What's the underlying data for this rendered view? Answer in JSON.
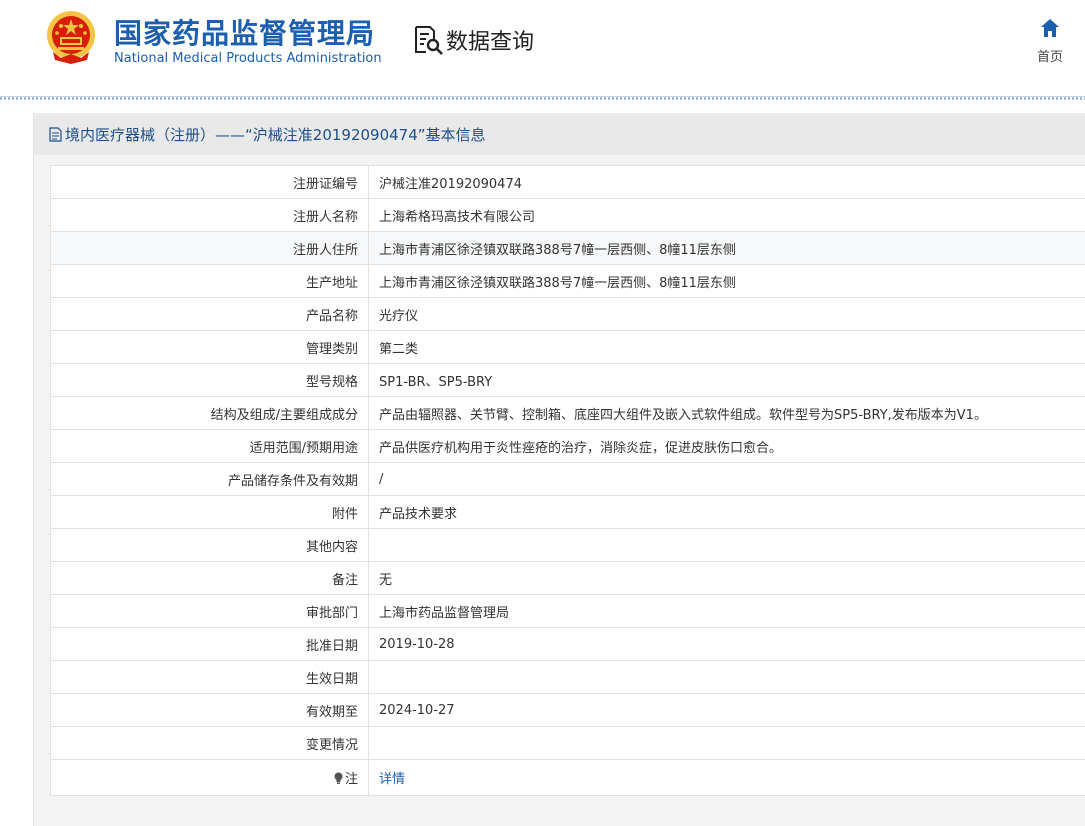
{
  "header": {
    "org_name_cn": "国家药品监督管理局",
    "org_name_en": "National Medical Products Administration",
    "query_label": "数据查询",
    "home_label": "首页"
  },
  "colors": {
    "brand_blue": "#1c5fae",
    "link_blue": "#1c5fae",
    "emblem_red": "#d81e06",
    "emblem_gold": "#f6c343"
  },
  "icons": {
    "emblem": "national-emblem-icon",
    "query": "document-search-icon",
    "home": "home-icon",
    "title": "document-icon",
    "note": "lightbulb-icon"
  },
  "panel": {
    "title": "境内医疗器械（注册）——“沪械注准20192090474”基本信息"
  },
  "rows": [
    {
      "label": "注册证编号",
      "value": "沪械注准20192090474"
    },
    {
      "label": "注册人名称",
      "value": "上海希格玛高技术有限公司"
    },
    {
      "label": "注册人住所",
      "value": "上海市青浦区徐泾镇双联路388号7幢一层西侧、8幢11层东侧"
    },
    {
      "label": "生产地址",
      "value": "上海市青浦区徐泾镇双联路388号7幢一层西侧、8幢11层东侧"
    },
    {
      "label": "产品名称",
      "value": "光疗仪"
    },
    {
      "label": "管理类别",
      "value": "第二类"
    },
    {
      "label": "型号规格",
      "value": "SP1-BR、SP5-BRY"
    },
    {
      "label": "结构及组成/主要组成成分",
      "value": "产品由辐照器、关节臂、控制箱、底座四大组件及嵌入式软件组成。软件型号为SP5-BRY,发布版本为V1。"
    },
    {
      "label": "适用范围/预期用途",
      "value": "产品供医疗机构用于炎性痤疮的治疗，消除炎症，促进皮肤伤口愈合。"
    },
    {
      "label": "产品储存条件及有效期",
      "value": "/"
    },
    {
      "label": "附件",
      "value": "产品技术要求"
    },
    {
      "label": "其他内容",
      "value": ""
    },
    {
      "label": "备注",
      "value": "无"
    },
    {
      "label": "审批部门",
      "value": "上海市药品监督管理局"
    },
    {
      "label": "批准日期",
      "value": "2019-10-28"
    },
    {
      "label": "生效日期",
      "value": ""
    },
    {
      "label": "有效期至",
      "value": "2024-10-27"
    },
    {
      "label": "变更情况",
      "value": ""
    }
  ],
  "note_row": {
    "label": "注",
    "link": "详情"
  }
}
